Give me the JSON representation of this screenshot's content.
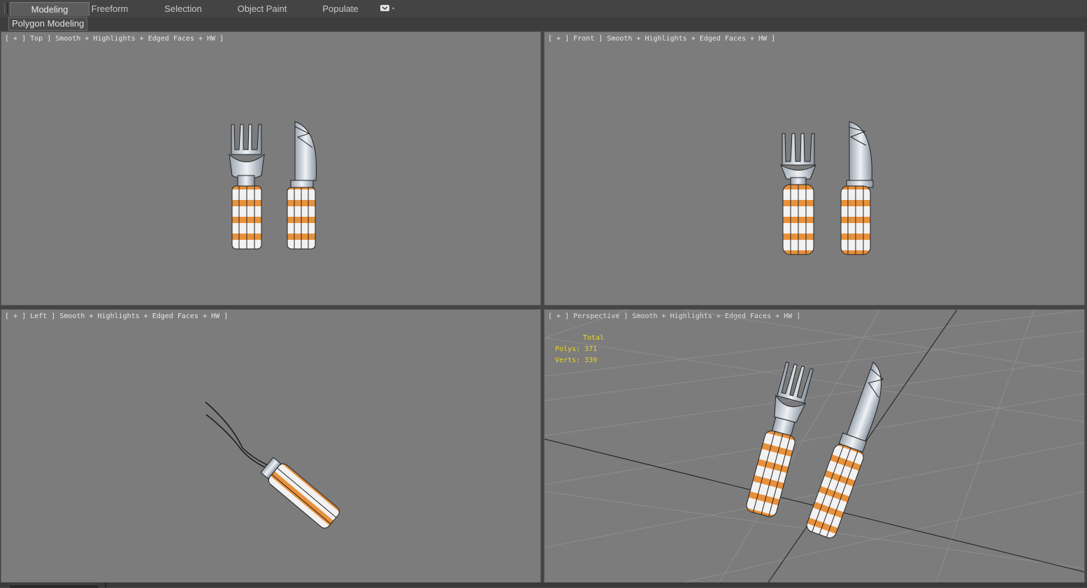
{
  "ribbon": {
    "tabs": [
      {
        "label": "Modeling",
        "active": true
      },
      {
        "label": "Freeform",
        "active": false
      },
      {
        "label": "Selection",
        "active": false
      },
      {
        "label": "Object Paint",
        "active": false
      },
      {
        "label": "Populate",
        "active": false
      }
    ],
    "dropdown_icon": "ribbon-display-options-icon",
    "panel_label": "Polygon Modeling"
  },
  "viewports": {
    "top": {
      "label": "[ + ] Top ] Smooth + Highlights + Edged Faces + HW ]"
    },
    "front": {
      "label": "[ + ] Front ] Smooth + Highlights + Edged Faces + HW ]"
    },
    "left": {
      "label": "[ + ] Left ] Smooth + Highlights + Edged Faces + HW ]"
    },
    "perspective": {
      "label": "[ + ] Perspective ] Smooth + Highlights + Edged Faces + HW ]",
      "stats": {
        "title": "Total",
        "polys": "Polys: 371",
        "verts": "Verts: 339"
      }
    }
  },
  "colors": {
    "viewport_bg": "#7c7c7c",
    "handle_orange": "#e8913c",
    "handle_white": "#f0f0f0",
    "metal": "#c8d0d8",
    "stats_text": "#e8d81a",
    "ui_dark": "#444444"
  }
}
